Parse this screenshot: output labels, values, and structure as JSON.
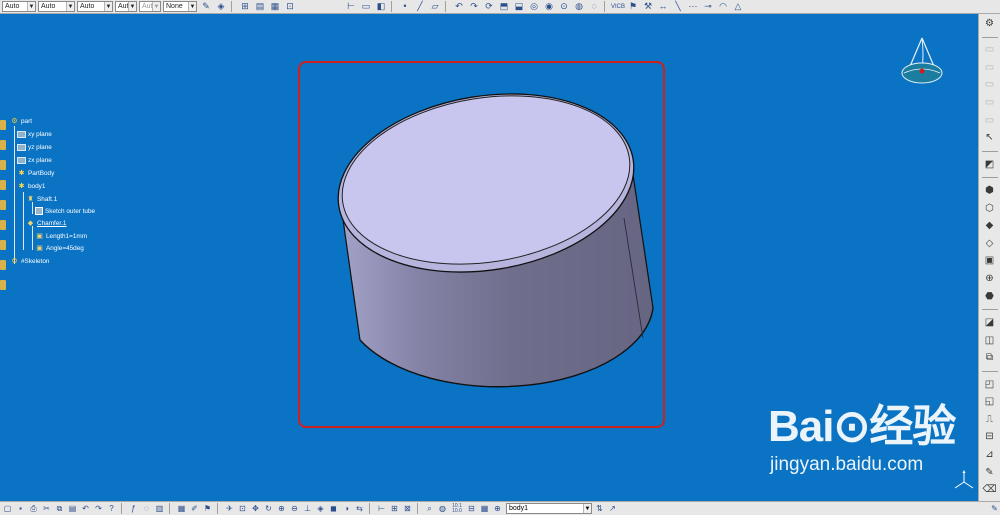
{
  "toolbar": {
    "combos": [
      {
        "name": "color-combo",
        "value": "Auto"
      },
      {
        "name": "transparency-combo",
        "value": "Auto"
      },
      {
        "name": "line-thickness-combo",
        "value": "Auto"
      },
      {
        "name": "line-type-combo",
        "value": "Aut"
      },
      {
        "name": "point-type-combo",
        "value": "Aut"
      },
      {
        "name": "layer-combo",
        "value": "None"
      }
    ]
  },
  "tree": {
    "root": "part",
    "xy_plane": "xy plane",
    "yz_plane": "yz plane",
    "zx_plane": "zx plane",
    "partbody": "PartBody",
    "body1": "body1",
    "shaft": "Shaft.1",
    "sketch": "Sketch outer tube",
    "chamfer": "Chamfer.1",
    "length": "Length1=1mm",
    "angle": "Angle=45deg",
    "skeleton": "#Skeleton"
  },
  "bottom": {
    "current_body": "body1",
    "scale_top": "10.1",
    "scale_bottom": "10.0"
  },
  "watermark": {
    "brand": "Bai⊙经验",
    "url": "jingyan.baidu.com"
  },
  "colors": {
    "background": "#0a73c4",
    "selection": "#cf2020",
    "solid_top": "#c8c6ef",
    "solid_side": "#7a799a"
  }
}
